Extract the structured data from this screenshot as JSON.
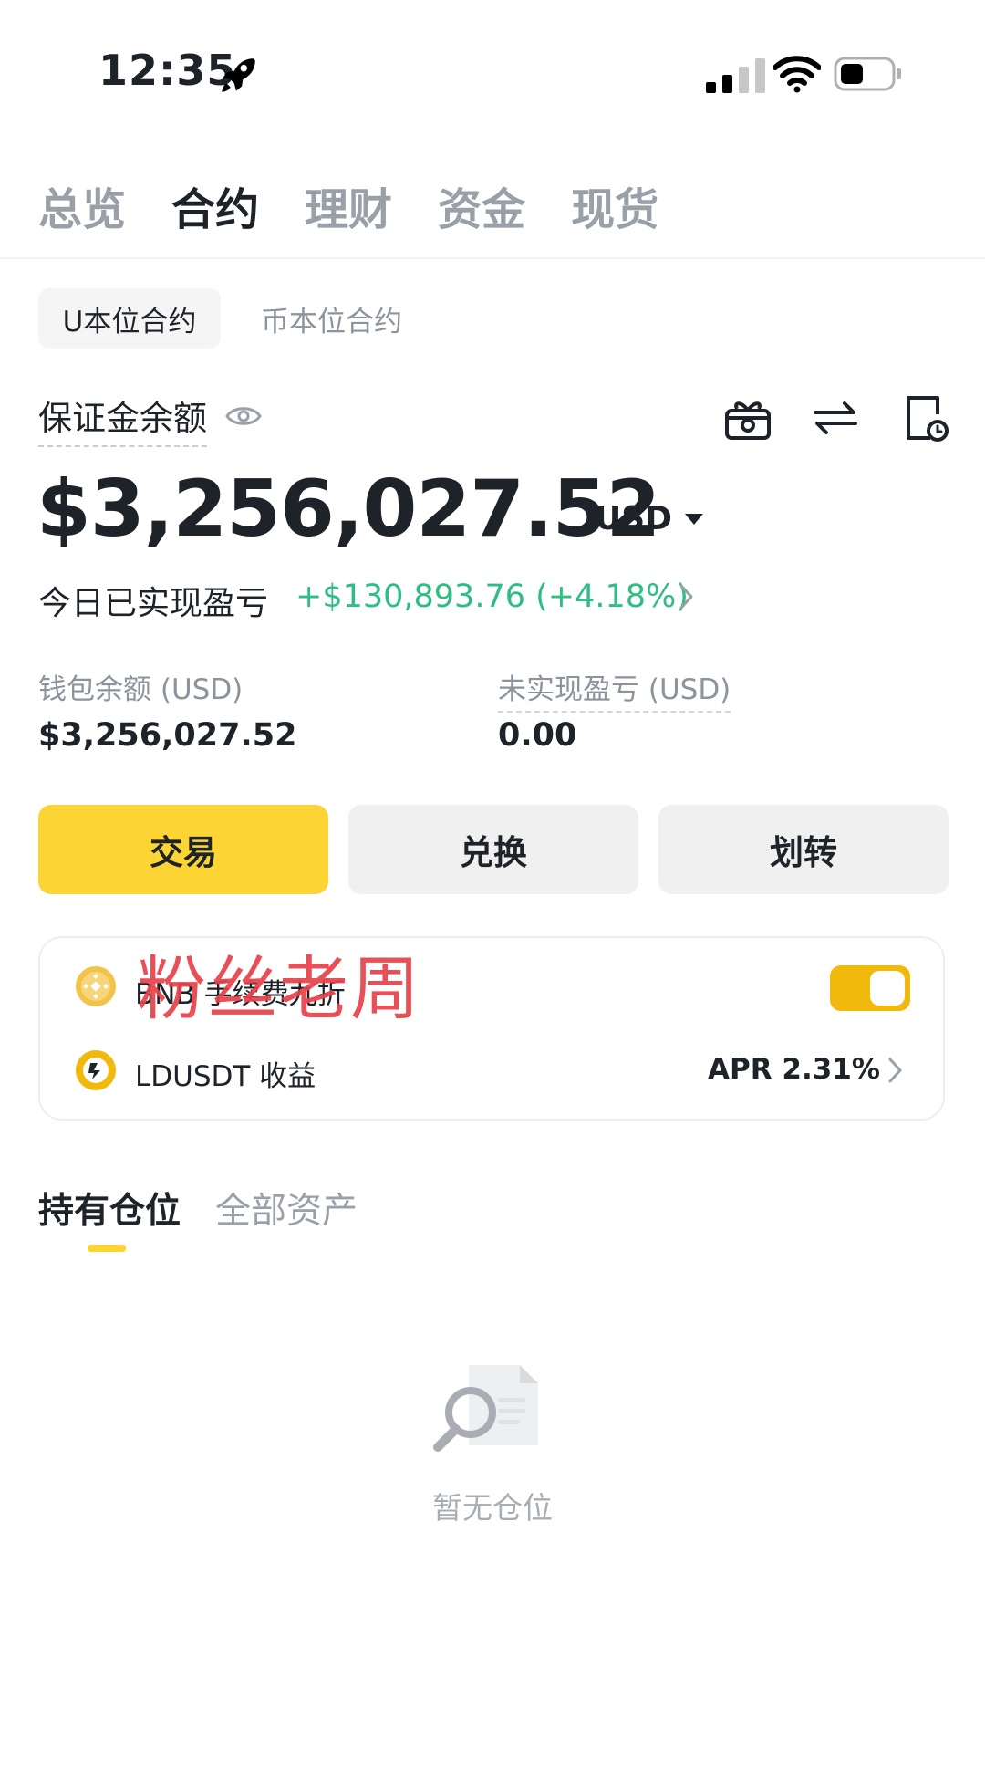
{
  "status_bar": {
    "time": "12:35",
    "icons": [
      "rocket-icon",
      "signal-icon",
      "wifi-icon",
      "battery-icon"
    ]
  },
  "top_tabs": [
    {
      "label": "总览",
      "active": false
    },
    {
      "label": "合约",
      "active": true
    },
    {
      "label": "理财",
      "active": false
    },
    {
      "label": "资金",
      "active": false
    },
    {
      "label": "现货",
      "active": false
    }
  ],
  "contract_tabs": [
    {
      "label": "U本位合约",
      "active": true
    },
    {
      "label": "币本位合约",
      "active": false
    }
  ],
  "margin": {
    "label": "保证金余额",
    "balance": "$3,256,027.52",
    "currency": "USD",
    "today_pnl_label": "今日已实现盈亏",
    "today_pnl_value": "+$130,893.76 (+4.18%)",
    "toolbar_icons": [
      "gift-icon",
      "swap-arrows-icon",
      "history-icon"
    ]
  },
  "stats": {
    "wallet_label": "钱包余额 (USD)",
    "wallet_value": "$3,256,027.52",
    "unrealized_label": "未实现盈亏 (USD)",
    "unrealized_value": "0.00"
  },
  "actions": {
    "trade": "交易",
    "convert": "兑换",
    "transfer": "划转"
  },
  "card": {
    "bnb_label": "BNB 手续费九折",
    "bnb_toggle_on": true,
    "ld_label": "LDUSDT 收益",
    "apr": "APR 2.31%"
  },
  "watermark": "粉丝老周",
  "positions": {
    "tabs": [
      {
        "label": "持有仓位",
        "active": true
      },
      {
        "label": "全部资产",
        "active": false
      }
    ],
    "empty_text": "暂无仓位"
  },
  "colors": {
    "brand_yellow": "#fcd535",
    "toggle_yellow": "#f0b90b",
    "profit_green": "#2ebd85",
    "watermark_red": "#e8424a"
  }
}
